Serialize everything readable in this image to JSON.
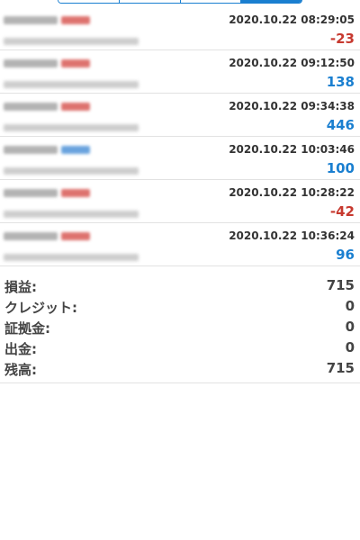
{
  "deals": [
    {
      "side": "sell",
      "time": "2020.10.22 08:29:05",
      "profit": "-23",
      "profit_sign": "neg"
    },
    {
      "side": "sell",
      "time": "2020.10.22 09:12:50",
      "profit": "138",
      "profit_sign": "pos"
    },
    {
      "side": "sell",
      "time": "2020.10.22 09:34:38",
      "profit": "446",
      "profit_sign": "pos"
    },
    {
      "side": "buy",
      "time": "2020.10.22 10:03:46",
      "profit": "100",
      "profit_sign": "pos"
    },
    {
      "side": "sell",
      "time": "2020.10.22 10:28:22",
      "profit": "-42",
      "profit_sign": "neg"
    },
    {
      "side": "sell",
      "time": "2020.10.22 10:36:24",
      "profit": "96",
      "profit_sign": "pos"
    }
  ],
  "summary": {
    "profit_label": "損益:",
    "profit_value": "715",
    "credit_label": "クレジット:",
    "credit_value": "0",
    "margin_label": "証拠金:",
    "margin_value": "0",
    "withdrawal_label": "出金:",
    "withdrawal_value": "0",
    "balance_label": "残高:",
    "balance_value": "715"
  },
  "colors": {
    "accent": "#1a7fd0",
    "negative": "#c7392f",
    "positive": "#1a7fd0"
  }
}
